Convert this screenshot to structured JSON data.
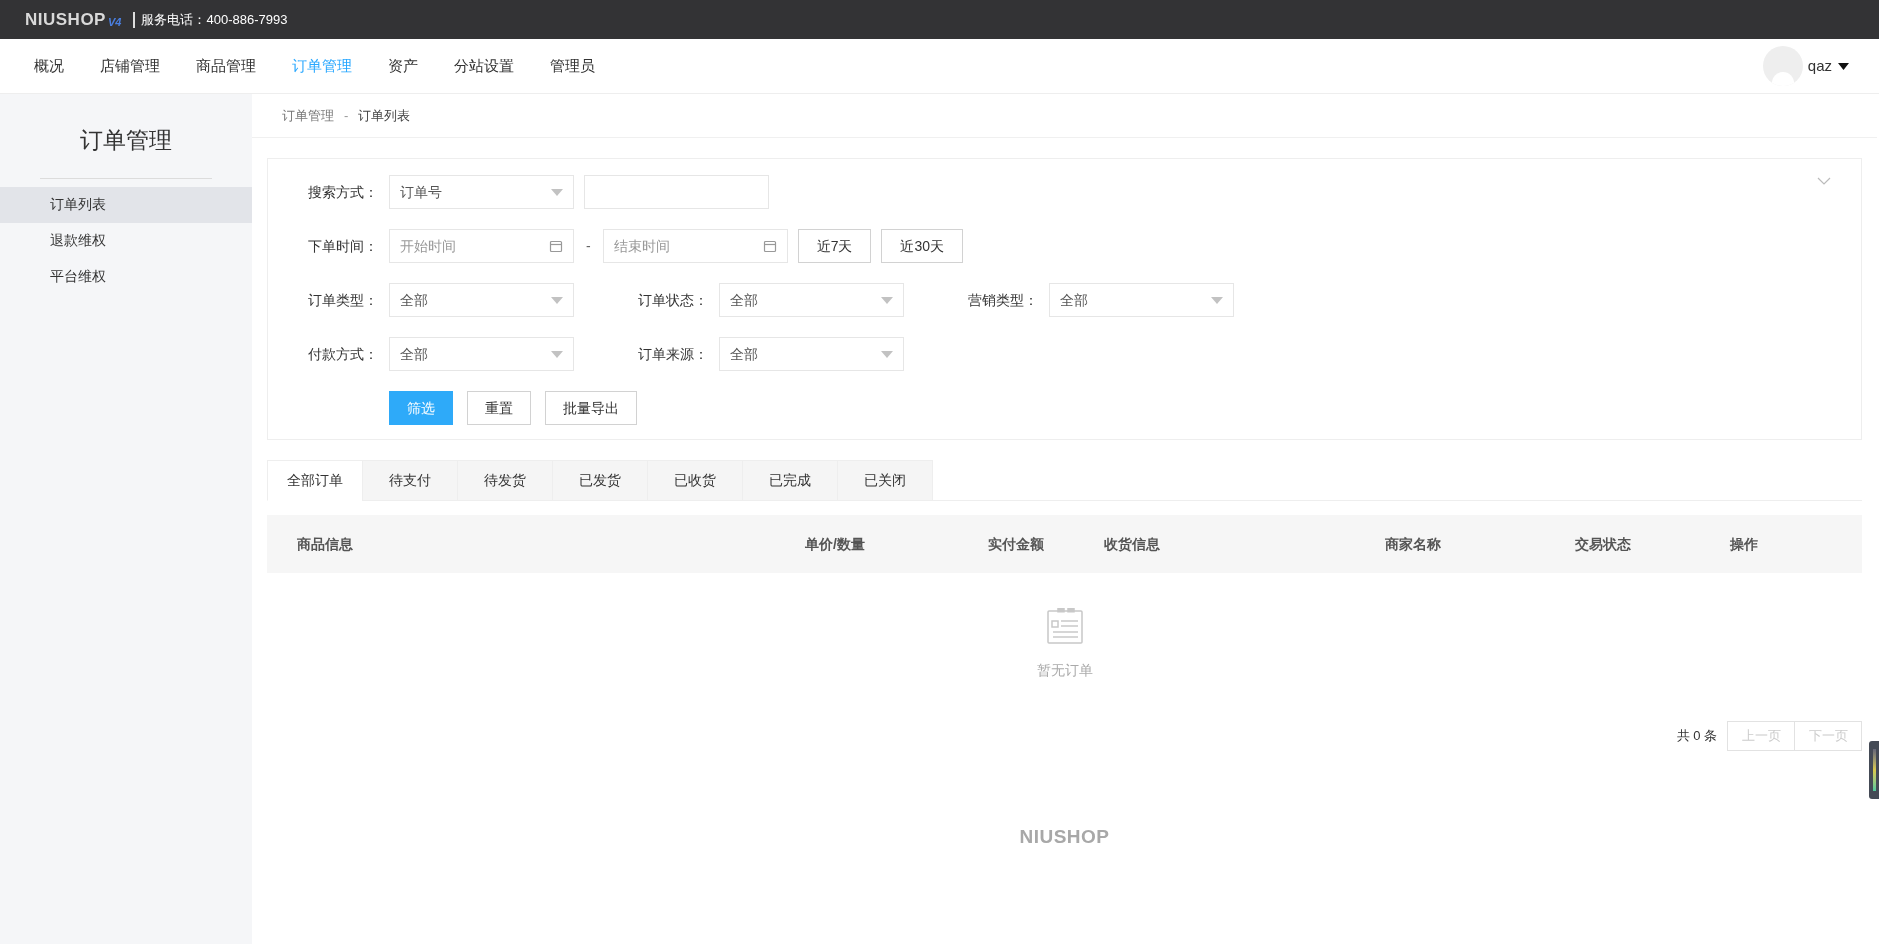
{
  "topbar": {
    "logo": "NIUSHOP",
    "logo_version": "V4",
    "hotline": "服务电话：400-886-7993"
  },
  "nav": {
    "items": [
      {
        "label": "概况",
        "selected": false
      },
      {
        "label": "店铺管理",
        "selected": false
      },
      {
        "label": "商品管理",
        "selected": false
      },
      {
        "label": "订单管理",
        "selected": true
      },
      {
        "label": "资产",
        "selected": false
      },
      {
        "label": "分站设置",
        "selected": false
      },
      {
        "label": "管理员",
        "selected": false
      }
    ],
    "user": "qaz"
  },
  "sidebar": {
    "title": "订单管理",
    "items": [
      {
        "label": "订单列表",
        "selected": true
      },
      {
        "label": "退款维权",
        "selected": false
      },
      {
        "label": "平台维权",
        "selected": false
      }
    ]
  },
  "breadcrumb": {
    "parent": "订单管理",
    "separator": "-",
    "current": "订单列表"
  },
  "filters": {
    "rows": [
      [
        {
          "label": "搜索方式：",
          "controls": [
            {
              "kind": "select",
              "value": "订单号"
            },
            {
              "kind": "text"
            }
          ]
        }
      ],
      [
        {
          "label": "下单时间：",
          "controls": [
            {
              "kind": "date",
              "placeholder": "开始时间"
            },
            {
              "kind": "separator",
              "text": "-"
            },
            {
              "kind": "date",
              "placeholder": "结束时间"
            },
            {
              "kind": "button",
              "label": "近7天"
            },
            {
              "kind": "button",
              "label": "近30天"
            }
          ]
        }
      ],
      [
        {
          "label": "订单类型：",
          "controls": [
            {
              "kind": "select",
              "value": "全部"
            }
          ]
        },
        {
          "label": "订单状态：",
          "controls": [
            {
              "kind": "select",
              "value": "全部"
            }
          ]
        },
        {
          "label": "营销类型：",
          "controls": [
            {
              "kind": "select",
              "value": "全部"
            }
          ]
        }
      ],
      [
        {
          "label": "付款方式：",
          "controls": [
            {
              "kind": "select",
              "value": "全部"
            }
          ]
        },
        {
          "label": "订单来源：",
          "controls": [
            {
              "kind": "select",
              "value": "全部"
            }
          ]
        }
      ]
    ],
    "buttons": [
      {
        "label": "筛选",
        "primary": true
      },
      {
        "label": "重置",
        "primary": false
      },
      {
        "label": "批量导出",
        "primary": false
      }
    ]
  },
  "tabs": [
    {
      "label": "全部订单",
      "selected": true
    },
    {
      "label": "待支付",
      "selected": false
    },
    {
      "label": "待发货",
      "selected": false
    },
    {
      "label": "已发货",
      "selected": false
    },
    {
      "label": "已收货",
      "selected": false
    },
    {
      "label": "已完成",
      "selected": false
    },
    {
      "label": "已关闭",
      "selected": false
    }
  ],
  "table": {
    "columns": [
      "商品信息",
      "单价/数量",
      "实付金额",
      "收货信息",
      "商家名称",
      "交易状态",
      "操作"
    ],
    "empty_text": "暂无订单"
  },
  "pagination": {
    "total": "共 0 条",
    "prev": "上一页",
    "next": "下一页",
    "prev_disabled": true,
    "next_disabled": true
  },
  "footer": {
    "logo": "NIUSHOP"
  }
}
